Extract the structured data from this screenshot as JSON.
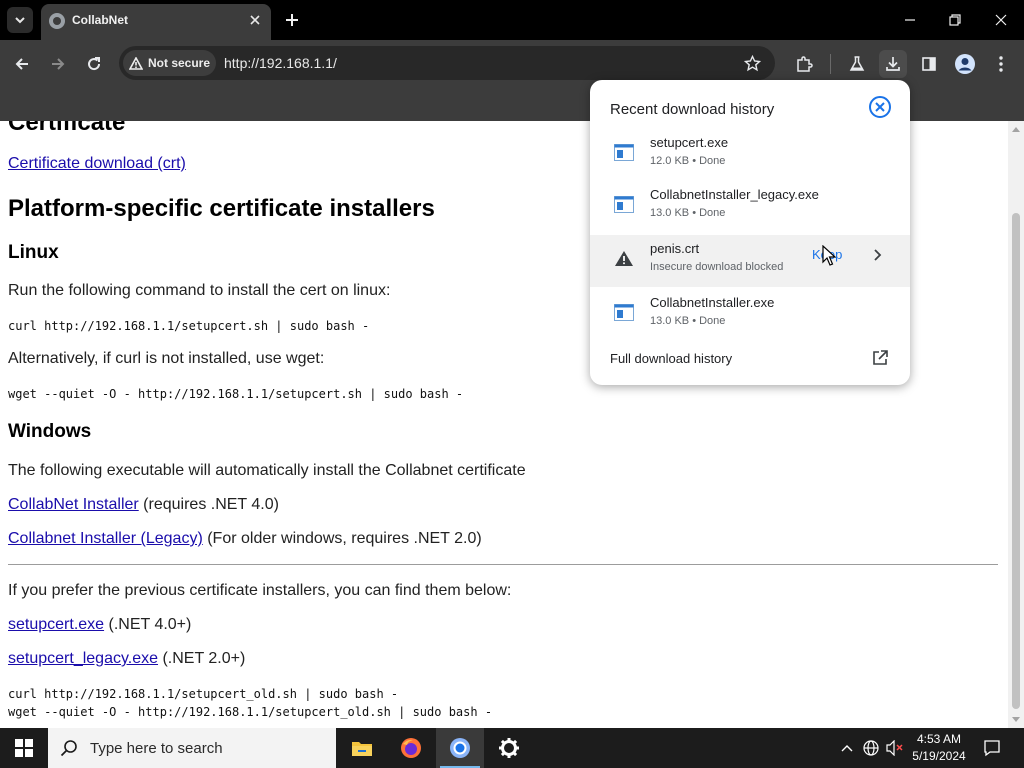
{
  "browser": {
    "tab_title": "CollabNet",
    "security_label": "Not secure",
    "url": "http://192.168.1.1/"
  },
  "page": {
    "heading_cut": "Certificate",
    "cert_download_link": "Certificate download (crt)",
    "platform_heading": "Platform-specific certificate installers",
    "linux_heading": "Linux",
    "linux_intro": "Run the following command to install the cert on linux:",
    "linux_cmd_curl": "curl http://192.168.1.1/setupcert.sh | sudo bash -",
    "linux_alt": "Alternatively, if curl is not installed, use wget:",
    "linux_cmd_wget": "wget --quiet -O - http://192.168.1.1/setupcert.sh | sudo bash -",
    "windows_heading": "Windows",
    "windows_intro": "The following executable will automatically install the Collabnet certificate",
    "installer_link": "CollabNet Installer",
    "installer_note": " (requires .NET 4.0)",
    "legacy_link": "Collabnet Installer (Legacy)",
    "legacy_note": " (For older windows, requires .NET 2.0)",
    "previous_intro": "If you prefer the previous certificate installers, you can find them below:",
    "setupcert_link": "setupcert.exe",
    "setupcert_note": " (.NET 4.0+)",
    "setupcert_legacy_link": "setupcert_legacy.exe",
    "setupcert_legacy_note": " (.NET 2.0+)",
    "old_cmd_curl": "curl http://192.168.1.1/setupcert_old.sh | sudo bash -",
    "old_cmd_wget": "wget --quiet -O - http://192.168.1.1/setupcert_old.sh | sudo bash -"
  },
  "downloads": {
    "title": "Recent download history",
    "items": [
      {
        "name": "setupcert.exe",
        "status": "12.0 KB • Done"
      },
      {
        "name": "CollabnetInstaller_legacy.exe",
        "status": "13.0 KB • Done"
      },
      {
        "name": "penis.crt",
        "status": "Insecure download blocked",
        "action": "Keep"
      },
      {
        "name": "CollabnetInstaller.exe",
        "status": "13.0 KB • Done"
      }
    ],
    "full_history": "Full download history"
  },
  "taskbar": {
    "search_placeholder": "Type here to search",
    "time": "4:53 AM",
    "date": "5/19/2024"
  },
  "colors": {
    "link": "#1a0dab",
    "accent_blue": "#1a73e8",
    "chrome_dark": "#3c3c3c"
  }
}
